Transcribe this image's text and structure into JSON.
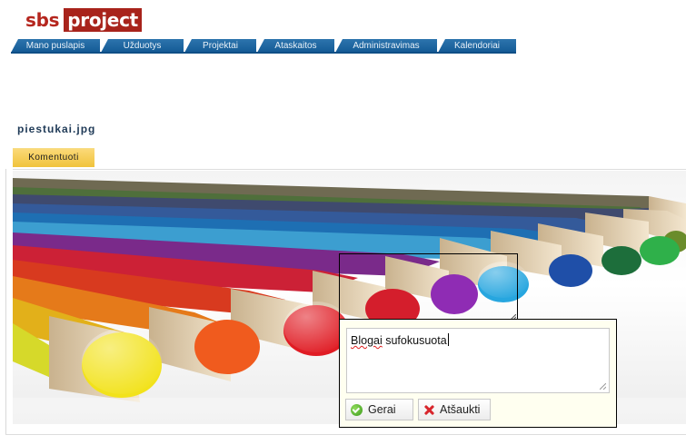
{
  "logo": {
    "part1": "sbs",
    "part2": "project"
  },
  "nav": {
    "tabs": [
      {
        "label": "Mano puslapis"
      },
      {
        "label": "Užduotys"
      },
      {
        "label": "Projektai"
      },
      {
        "label": "Ataskaitos"
      },
      {
        "label": "Administravimas"
      },
      {
        "label": "Kalendoriai"
      }
    ]
  },
  "file": {
    "title": "piestukai.jpg"
  },
  "comment_button": {
    "label": "Komentuoti"
  },
  "note": {
    "text_word1": "Blogai",
    "text_word2": "sufokusuota",
    "ok_label": "Gerai",
    "cancel_label": "Atšaukti"
  },
  "colors": {
    "brand_red": "#a8231b",
    "nav_blue": "#135a95",
    "comment_yellow": "#f0c33b",
    "note_bg": "#fffff0"
  }
}
